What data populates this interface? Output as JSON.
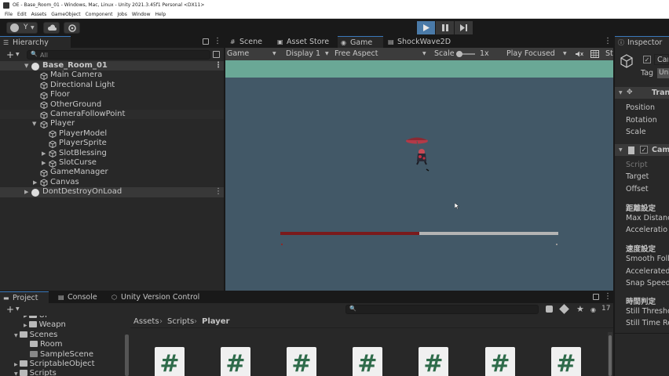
{
  "window": {
    "title": "OE - Base_Room_01 - Windows, Mac, Linux - Unity 2021.3.45f1 Personal <DX11>"
  },
  "menu": [
    "File",
    "Edit",
    "Assets",
    "GameObject",
    "Component",
    "Jobs",
    "Window",
    "Help"
  ],
  "toolbar": {
    "account_label": "Y"
  },
  "hierarchy": {
    "tab": "Hierarchy",
    "search_placeholder": "All",
    "scene": "Base_Room_01",
    "items": [
      {
        "label": "Main Camera"
      },
      {
        "label": "Directional Light"
      },
      {
        "label": "Floor"
      },
      {
        "label": "OtherGround"
      },
      {
        "label": "CameraFollowPoint"
      },
      {
        "label": "Player"
      },
      {
        "label": "PlayerModel"
      },
      {
        "label": "PlayerSprite"
      },
      {
        "label": "SlotBlessing"
      },
      {
        "label": "SlotCurse"
      },
      {
        "label": "GameManager"
      },
      {
        "label": "Canvas"
      }
    ],
    "ddol": "DontDestroyOnLoad"
  },
  "center_tabs": [
    "Scene",
    "Asset Store",
    "Game",
    "ShockWave2D"
  ],
  "game_toolbar": {
    "mode": "Game",
    "display": "Display 1",
    "aspect": "Free Aspect",
    "scale_label": "Scale",
    "scale_value": "1x",
    "play_mode": "Play Focused",
    "stats": "St"
  },
  "game": {
    "health_fill": 0.5
  },
  "inspector": {
    "tab": "Inspector",
    "object_name": "Cam",
    "tag_label": "Tag",
    "tag_value": "Un",
    "transform_header": "Tran",
    "transform_fields": [
      "Position",
      "Rotation",
      "Scale"
    ],
    "component_header": "Cam",
    "script_label": "Script",
    "fields_a": [
      "Target",
      "Offset"
    ],
    "section1": "距離設定",
    "fields_b": [
      "Max Distanc",
      "Acceleratio"
    ],
    "section2": "速度設定",
    "fields_c": [
      "Smooth Follo",
      "Accelerated",
      "Snap Speed"
    ],
    "section3": "時間判定",
    "fields_d": [
      "Still Thresho",
      "Still Time Re"
    ]
  },
  "project": {
    "tabs": [
      "Project",
      "Console",
      "Unity Version Control"
    ],
    "tree": [
      "UI",
      "Weapn",
      "Scenes",
      "Room",
      "SampleScene",
      "ScriptableObject",
      "Scripts"
    ],
    "breadcrumb": [
      "Assets",
      "Scripts",
      "Player"
    ],
    "hidden_count": "17",
    "script_glyph": "#"
  },
  "colors": {
    "accent": "#3a79bb",
    "game_bg": "#425867",
    "game_sky": "#6aa896",
    "health_red": "#7a1a1c",
    "health_empty": "#b4b4b4"
  }
}
